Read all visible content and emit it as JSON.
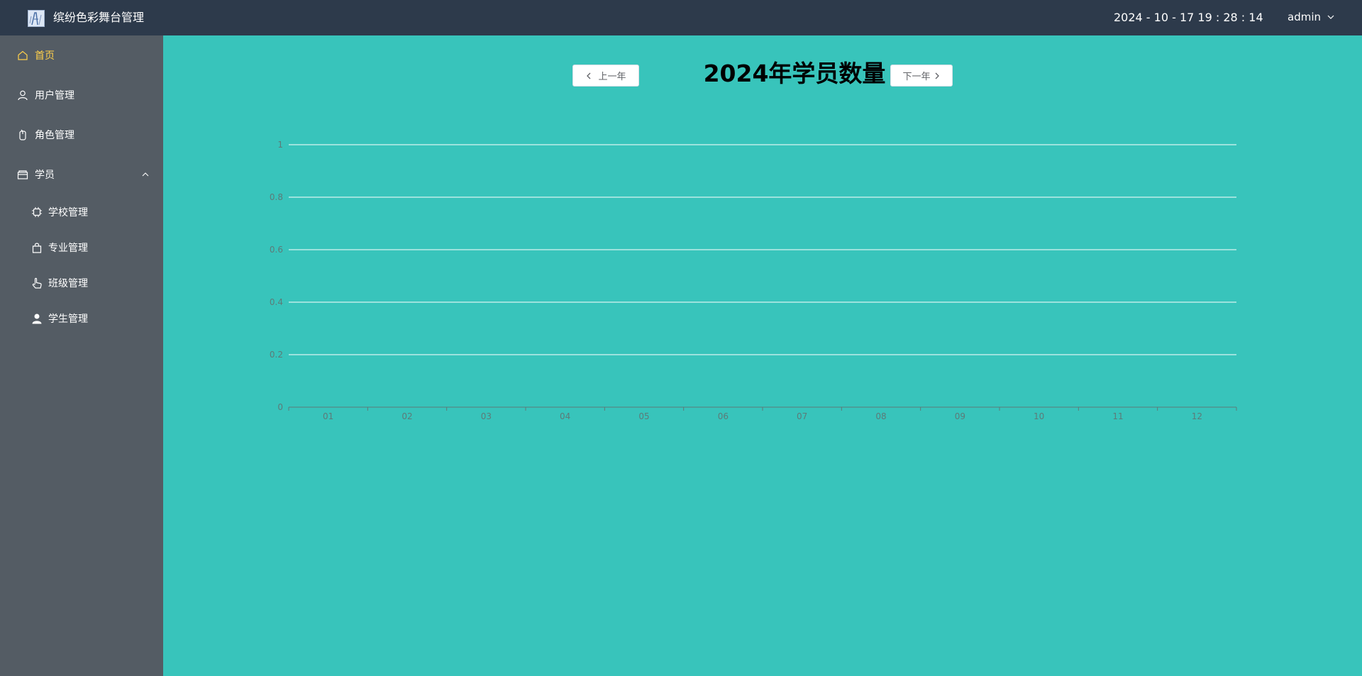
{
  "header": {
    "app_title": "缤纷色彩舞台管理",
    "datetime": "2024 - 10 - 17 19 : 28 : 14",
    "user": "admin"
  },
  "sidebar": {
    "active_color": "#ffd04b",
    "items": [
      {
        "label": "首页",
        "icon": "home-icon",
        "active": true
      },
      {
        "label": "用户管理",
        "icon": "user-icon"
      },
      {
        "label": "角色管理",
        "icon": "mouse-icon"
      },
      {
        "label": "学员",
        "icon": "folder-icon",
        "expanded": true
      }
    ],
    "subitems": [
      {
        "label": "学校管理",
        "icon": "cpu-icon"
      },
      {
        "label": "专业管理",
        "icon": "shopping-bag-icon"
      },
      {
        "label": "班级管理",
        "icon": "pointer-icon"
      },
      {
        "label": "学生管理",
        "icon": "user-solid-icon"
      }
    ]
  },
  "main": {
    "prev_label": "上一年",
    "next_label": "下一年",
    "chart_title": "2024年学员数量",
    "background": "#38c4bb"
  },
  "chart_data": {
    "type": "bar",
    "title": "2024年学员数量",
    "categories": [
      "01",
      "02",
      "03",
      "04",
      "05",
      "06",
      "07",
      "08",
      "09",
      "10",
      "11",
      "12"
    ],
    "values": [
      0,
      0,
      0,
      0,
      0,
      0,
      0,
      0,
      0,
      0,
      0,
      0
    ],
    "ylim": [
      0,
      1
    ],
    "yticks": [
      "0",
      "0.2",
      "0.4",
      "0.6",
      "0.8",
      "1"
    ],
    "grid": true
  }
}
